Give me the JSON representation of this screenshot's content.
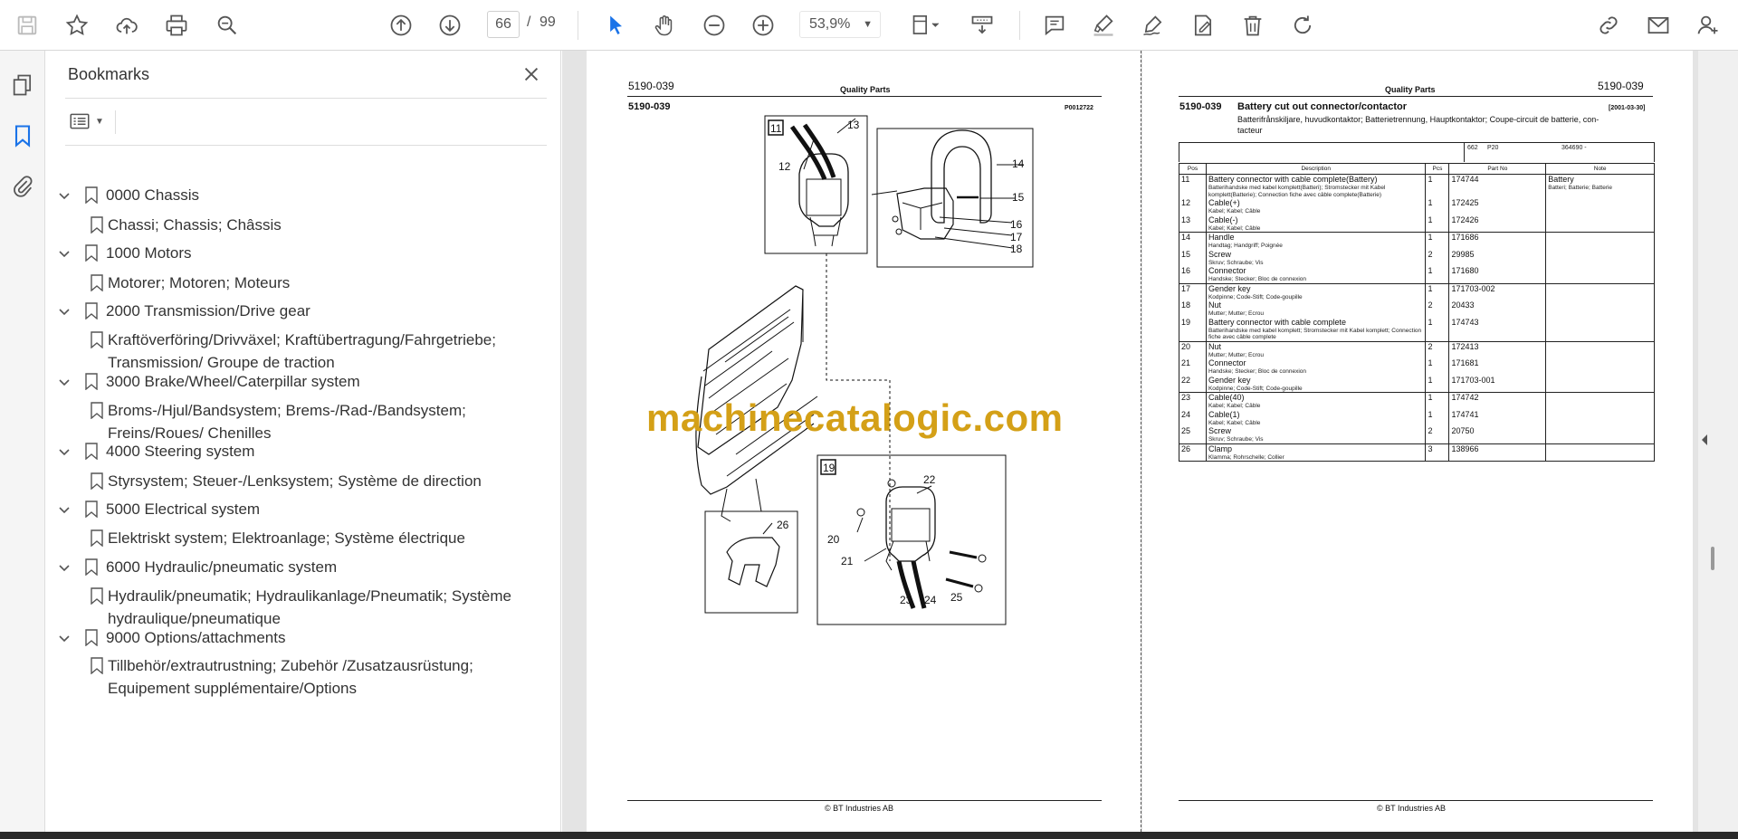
{
  "toolbar": {
    "page_current": "66",
    "page_separator": "/",
    "page_total": "99",
    "zoom": "53,9%",
    "icons": [
      "save-icon",
      "star-icon",
      "upload-icon",
      "print-icon",
      "zoom-search-icon",
      "page-up-icon",
      "page-down-icon",
      "zoom-out-icon",
      "zoom-in-icon",
      "select-arrow-icon",
      "hand-icon",
      "fit-page-icon",
      "scroll-mode-icon",
      "comment-icon",
      "highlight-icon",
      "sign-icon",
      "edit-pdf-icon",
      "delete-icon",
      "rotate-icon",
      "share-link-icon",
      "email-icon",
      "user-icon"
    ]
  },
  "bookmarks": {
    "title": "Bookmarks",
    "items": [
      {
        "label": "0000 Chassis",
        "children": [
          [
            "Chassi; Chassis; Châssis"
          ]
        ]
      },
      {
        "label": "1000 Motors",
        "children": [
          [
            "Motorer; Motoren; Moteurs"
          ]
        ]
      },
      {
        "label": "2000 Transmission/Drive gear",
        "children": [
          [
            "Kraftöverföring/Drivväxel; Kraftübertragung/Fahrgetriebe;",
            "Transmission/ Groupe de traction"
          ]
        ]
      },
      {
        "label": "3000 Brake/Wheel/Caterpillar system",
        "children": [
          [
            "Broms-/Hjul/Bandsystem; Brems-/Rad-/Bandsystem;",
            "Freins/Roues/ Chenilles"
          ]
        ]
      },
      {
        "label": "4000 Steering system",
        "children": [
          [
            "Styrsystem; Steuer-/Lenksystem; Système de direction"
          ]
        ]
      },
      {
        "label": "5000 Electrical system",
        "children": [
          [
            "Elektriskt system; Elektroanlage; Système électrique"
          ]
        ]
      },
      {
        "label": "6000 Hydraulic/pneumatic system",
        "children": [
          [
            "Hydraulik/pneumatik; Hydraulikanlage/Pneumatik; Système",
            "hydraulique/pneumatique"
          ]
        ]
      },
      {
        "label": "9000 Options/attachments",
        "children": [
          [
            "Tillbehör/extrautrustning; Zubehör /Zusatzausrüstung;",
            "Equipement supplémentaire/Options"
          ]
        ]
      }
    ]
  },
  "page_left": {
    "doc_no": "5190-039",
    "header": "Quality Parts",
    "subno": "5190-039",
    "ref": "P0012722",
    "callouts": [
      "11",
      "12",
      "13",
      "14",
      "15",
      "16",
      "17",
      "18",
      "19",
      "20",
      "21",
      "22",
      "23",
      "24",
      "25",
      "26"
    ],
    "footer": "© BT Industries AB"
  },
  "watermark": "machinecatalogic.com",
  "page_right": {
    "header": "Quality Parts",
    "doc_no": "5190-039",
    "subno": "5190-039",
    "title": "Battery cut out connector/contactor",
    "date": "[2001-03-30]",
    "subtitle_1": "Batterifrånskiljare, huvudkontaktor; Batterietrennung, Hauptkontaktor; Coupe-circuit de batterie, con-",
    "subtitle_2": "tacteur",
    "filter": [
      "662",
      "P20",
      "364690 -"
    ],
    "columns": [
      "Pos",
      "Description",
      "Pcs",
      "Part No",
      "Note"
    ],
    "rows": [
      {
        "pos": "11",
        "desc": "Battery connector with cable complete(Battery)",
        "sub": "Batterihandske med kabel komplett(Batteri); Stromstecker mit Kabel komplett(Batterie); Connection fiche avec câble complete(Batterie)",
        "pcs": "1",
        "part": "174744",
        "note": "Battery",
        "note_sub": "Batteri; Batterie; Batterie",
        "group": true
      },
      {
        "pos": "12",
        "desc": "Cable(+)",
        "sub": "Kabel; Kabel; Câble",
        "pcs": "1",
        "part": "172425",
        "note": "",
        "note_sub": "",
        "group": false
      },
      {
        "pos": "13",
        "desc": "Cable(-)",
        "sub": "Kabel; Kabel; Câble",
        "pcs": "1",
        "part": "172426",
        "note": "",
        "note_sub": "",
        "group": false
      },
      {
        "pos": "14",
        "desc": "Handle",
        "sub": "Handtag; Handgriff; Poignée",
        "pcs": "1",
        "part": "171686",
        "note": "",
        "note_sub": "",
        "group": true
      },
      {
        "pos": "15",
        "desc": "Screw",
        "sub": "Skruv; Schraube; Vis",
        "pcs": "2",
        "part": "29985",
        "note": "",
        "note_sub": "",
        "group": false
      },
      {
        "pos": "16",
        "desc": "Connector",
        "sub": "Handske; Stecker; Bloc de connexion",
        "pcs": "1",
        "part": "171680",
        "note": "",
        "note_sub": "",
        "group": false
      },
      {
        "pos": "17",
        "desc": "Gender key",
        "sub": "Kodpinne; Code-Stift; Code-goupille",
        "pcs": "1",
        "part": "171703-002",
        "note": "",
        "note_sub": "",
        "group": true
      },
      {
        "pos": "18",
        "desc": "Nut",
        "sub": "Mutter; Mutter; Ecrou",
        "pcs": "2",
        "part": "20433",
        "note": "",
        "note_sub": "",
        "group": false
      },
      {
        "pos": "19",
        "desc": "Battery connector with cable complete",
        "sub": "Batterihandske med kabel komplett; Stromstecker mit Kabel komplett; Connection fiche avec câble complete",
        "pcs": "1",
        "part": "174743",
        "note": "",
        "note_sub": "",
        "group": false
      },
      {
        "pos": "20",
        "desc": "Nut",
        "sub": "Mutter; Mutter; Ecrou",
        "pcs": "2",
        "part": "172413",
        "note": "",
        "note_sub": "",
        "group": true
      },
      {
        "pos": "21",
        "desc": "Connector",
        "sub": "Handske; Stecker; Bloc de connexion",
        "pcs": "1",
        "part": "171681",
        "note": "",
        "note_sub": "",
        "group": false
      },
      {
        "pos": "22",
        "desc": "Gender key",
        "sub": "Kodpinne; Code-Stift; Code-goupille",
        "pcs": "1",
        "part": "171703-001",
        "note": "",
        "note_sub": "",
        "group": false
      },
      {
        "pos": "23",
        "desc": "Cable(40)",
        "sub": "Kabel; Kabel; Câble",
        "pcs": "1",
        "part": "174742",
        "note": "",
        "note_sub": "",
        "group": true
      },
      {
        "pos": "24",
        "desc": "Cable(1)",
        "sub": "Kabel; Kabel; Câble",
        "pcs": "1",
        "part": "174741",
        "note": "",
        "note_sub": "",
        "group": false
      },
      {
        "pos": "25",
        "desc": "Screw",
        "sub": "Skruv; Schraube; Vis",
        "pcs": "2",
        "part": "20750",
        "note": "",
        "note_sub": "",
        "group": false
      },
      {
        "pos": "26",
        "desc": "Clamp",
        "sub": "Klamma; Rohrschelle; Collier",
        "pcs": "3",
        "part": "138966",
        "note": "",
        "note_sub": "",
        "group": true
      }
    ],
    "footer": "© BT Industries AB"
  }
}
